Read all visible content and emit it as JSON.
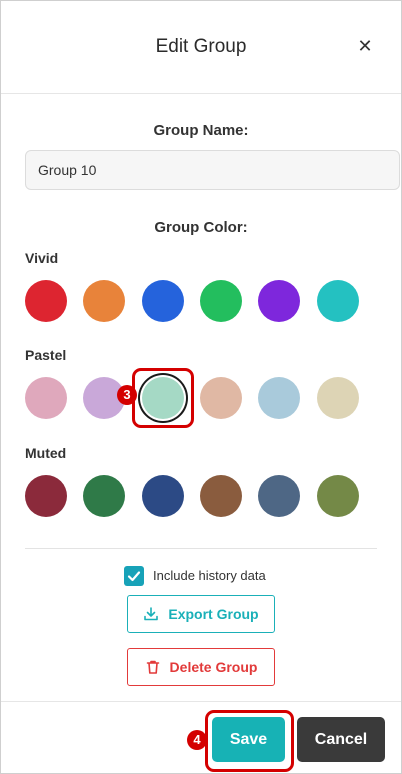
{
  "header": {
    "title": "Edit Group",
    "close_icon": "close-icon"
  },
  "group_name": {
    "label": "Group Name:",
    "value": "Group 10"
  },
  "group_color": {
    "label": "Group Color:",
    "palettes": [
      {
        "name": "Vivid",
        "colors": [
          "#dd2530",
          "#e8833a",
          "#2563dc",
          "#23be5e",
          "#7e27dc",
          "#24c1c1"
        ]
      },
      {
        "name": "Pastel",
        "colors": [
          "#dfa8bc",
          "#c9a8d9",
          "#a5d9c5",
          "#e0b8a4",
          "#a9cadb",
          "#ddd4b5"
        ],
        "selected_index": 2
      },
      {
        "name": "Muted",
        "colors": [
          "#8b2a3b",
          "#2f7a48",
          "#2c4a85",
          "#8a5c3e",
          "#4e6785",
          "#748947"
        ]
      }
    ]
  },
  "history": {
    "label": "Include history data",
    "checked": true
  },
  "buttons": {
    "export": "Export Group",
    "delete": "Delete Group",
    "save": "Save",
    "cancel": "Cancel"
  },
  "annotations": {
    "step_color": "3",
    "step_save": "4",
    "highlight_color": "#d40000"
  }
}
